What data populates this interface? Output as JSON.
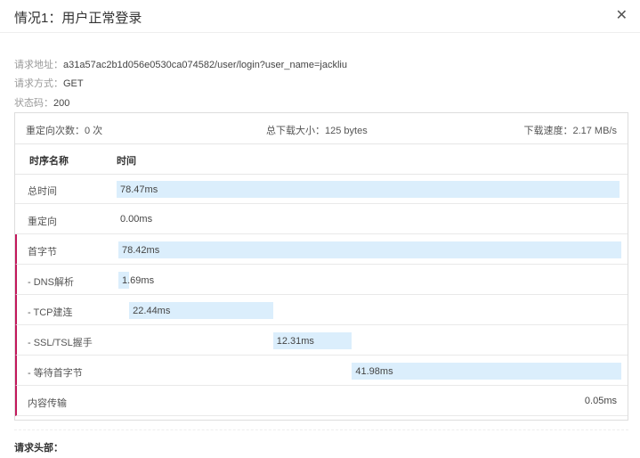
{
  "dialog": {
    "title": "情况1：用户正常登录",
    "close_icon": "close-icon"
  },
  "info": {
    "url_label": "请求地址：",
    "url_value": "a31a57ac2b1d056e0530ca074582/user/login?user_name=jackliu",
    "method_label": "请求方式：",
    "method_value": "GET",
    "status_label": "状态码：",
    "status_value": "200"
  },
  "summary": {
    "redirects": "重定向次数：0 次",
    "size": "总下载大小：125 bytes",
    "speed": "下载速度：2.17 MB/s"
  },
  "table": {
    "headers": [
      "时序名称",
      "时间"
    ],
    "rows": [
      {
        "name": "总时间",
        "value": "78.47ms",
        "ms": 78.47,
        "start_ms": 0,
        "accent": false
      },
      {
        "name": "重定向",
        "value": "0.00ms",
        "ms": 0.0,
        "start_ms": 0,
        "accent": false
      },
      {
        "name": "首字节",
        "value": "78.42ms",
        "ms": 78.42,
        "start_ms": 0,
        "accent": true
      },
      {
        "name": "- DNS解析",
        "value": "1.69ms",
        "ms": 1.69,
        "start_ms": 0,
        "accent": true
      },
      {
        "name": "- TCP建连",
        "value": "22.44ms",
        "ms": 22.44,
        "start_ms": 1.69,
        "accent": true
      },
      {
        "name": "- SSL/TSL握手",
        "value": "12.31ms",
        "ms": 12.31,
        "start_ms": 24.13,
        "accent": true
      },
      {
        "name": "- 等待首字节",
        "value": "41.98ms",
        "ms": 41.98,
        "start_ms": 36.44,
        "accent": true
      },
      {
        "name": "内容传输",
        "value": "0.05ms",
        "ms": 0.05,
        "start_ms": 78.42,
        "accent": true
      }
    ]
  },
  "section": {
    "request_headers": "请求头部："
  },
  "colors": {
    "bar": "#dbeefc",
    "accent": "#c2185b"
  }
}
